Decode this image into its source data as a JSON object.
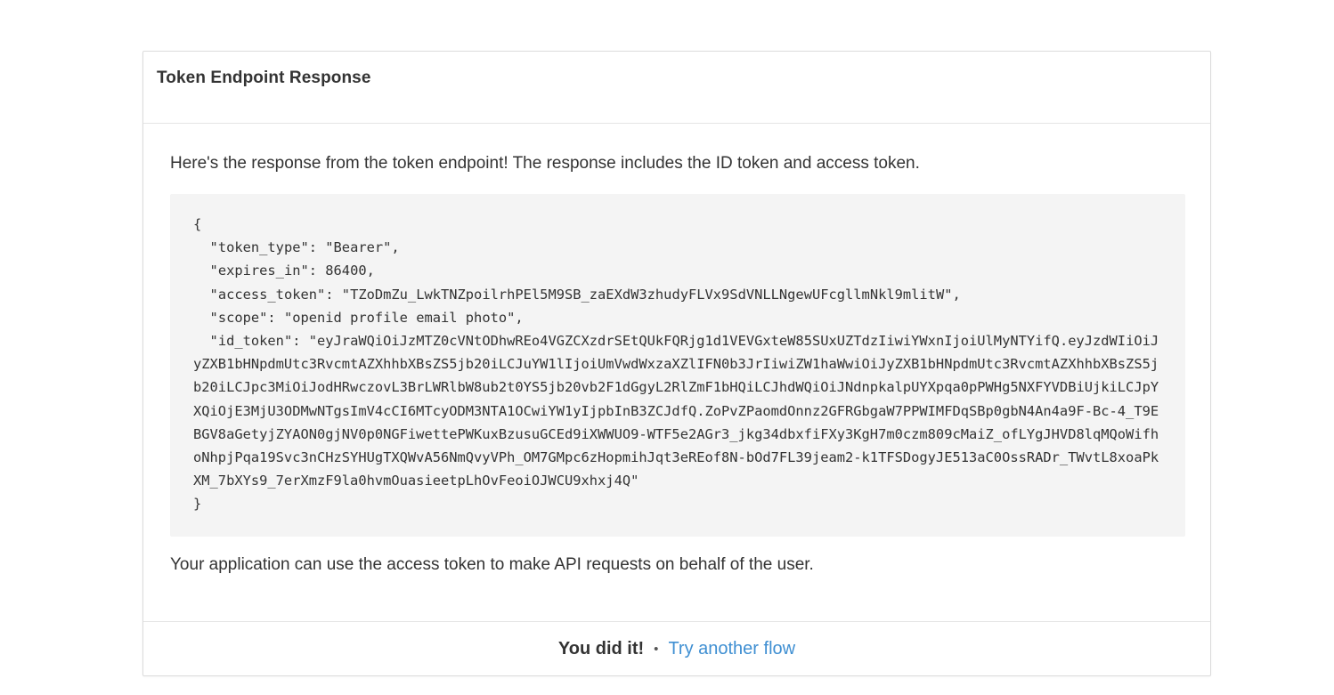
{
  "card": {
    "title": "Token Endpoint Response",
    "intro": "Here's the response from the token endpoint! The response includes the ID token and access token.",
    "response_json": "{\n  \"token_type\": \"Bearer\",\n  \"expires_in\": 86400,\n  \"access_token\": \"TZoDmZu_LwkTNZpoilrhPEl5M9SB_zaEXdW3zhudyFLVx9SdVNLLNgewUFcgllmNkl9mlitW\",\n  \"scope\": \"openid profile email photo\",\n  \"id_token\": \"eyJraWQiOiJzMTZ0cVNtODhwREo4VGZCXzdrSEtQUkFQRjg1d1VEVGxteW85SUxUZTdzIiwiYWxnIjoiUlMyNTYifQ.eyJzdWIiOiJyZXB1bHNpdmUtc3RvcmtAZXhhbXBsZS5jb20iLCJuYW1lIjoiUmVwdWxzaXZlIFN0b3JrIiwiZW1haWwiOiJyZXB1bHNpdmUtc3RvcmtAZXhhbXBsZS5jb20iLCJpc3MiOiJodHRwczovL3BrLWRlbW8ub2t0YS5jb20vb2F1dGgyL2RlZmF1bHQiLCJhdWQiOiJNdnpkalpUYXpqa0pPWHg5NXFYVDBiUjkiLCJpYXQiOjE3MjU3ODMwNTgsImV4cCI6MTcyODM3NTA1OCwiYW1yIjpbInB3ZCJdfQ.ZoPvZPaomdOnnz2GFRGbgaW7PPWIMFDqSBp0gbN4An4a9F-Bc-4_T9EBGV8aGetyjZYAON0gjNV0p0NGFiwettePWKuxBzusuGCEd9iXWWUO9-WTF5e2AGr3_jkg34dbxfiFXy3KgH7m0czm809cMaiZ_ofLYgJHVD8lqMQoWifhoNhpjPqa19Svc3nCHzSYHUgTXQWvA56NmQvyVPh_OM7GMpc6zHopmihJqt3eREof8N-bOd7FL39jeam2-k1TFSDogyJE513aC0OssRADr_TWvtL8xoaPkXM_7bXYs9_7erXmzF9la0hvmOuasieetpLhOvFeoiOJWCU9xhxj4Q\"\n}",
    "outro": "Your application can use the access token to make API requests on behalf of the user."
  },
  "footer": {
    "done_label": "You did it!",
    "separator": "•",
    "link_label": "Try another flow"
  },
  "colors": {
    "link": "#3f8fd2",
    "code_background": "#f4f4f4",
    "border": "#dcdcdc",
    "text": "#333333"
  }
}
